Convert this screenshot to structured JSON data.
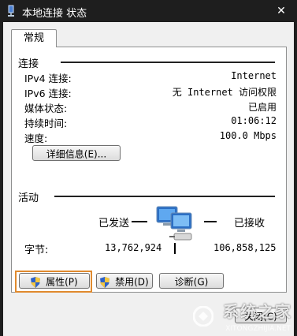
{
  "window": {
    "title": "本地连接 状态",
    "close_glyph": "✕"
  },
  "tabs": [
    {
      "label": "常规"
    }
  ],
  "connection": {
    "title": "连接",
    "rows": [
      {
        "label": "IPv4 连接:",
        "value": "Internet"
      },
      {
        "label": "IPv6 连接:",
        "value": "无 Internet 访问权限"
      },
      {
        "label": "媒体状态:",
        "value": "已启用"
      },
      {
        "label": "持续时间:",
        "value": "01:06:12"
      },
      {
        "label": "速度:",
        "value": "100.0 Mbps"
      }
    ],
    "details_button": "详细信息(E)..."
  },
  "activity": {
    "title": "活动",
    "sent_label": "已发送",
    "received_label": "已接收",
    "bytes_label": "字节:",
    "bytes_sent": "13,762,924",
    "bytes_received": "106,858,125"
  },
  "buttons": {
    "properties": "属性(P)",
    "disable": "禁用(D)",
    "diagnose": "诊断(G)",
    "close": "关闭(C)"
  },
  "watermark": {
    "brand": "系统之家",
    "url": "XITONGZHIJIA.NET"
  },
  "colors": {
    "highlight": "#e08a2e",
    "titlebar": "#1e1e1e",
    "dialog_bg": "#f0f0f0"
  }
}
